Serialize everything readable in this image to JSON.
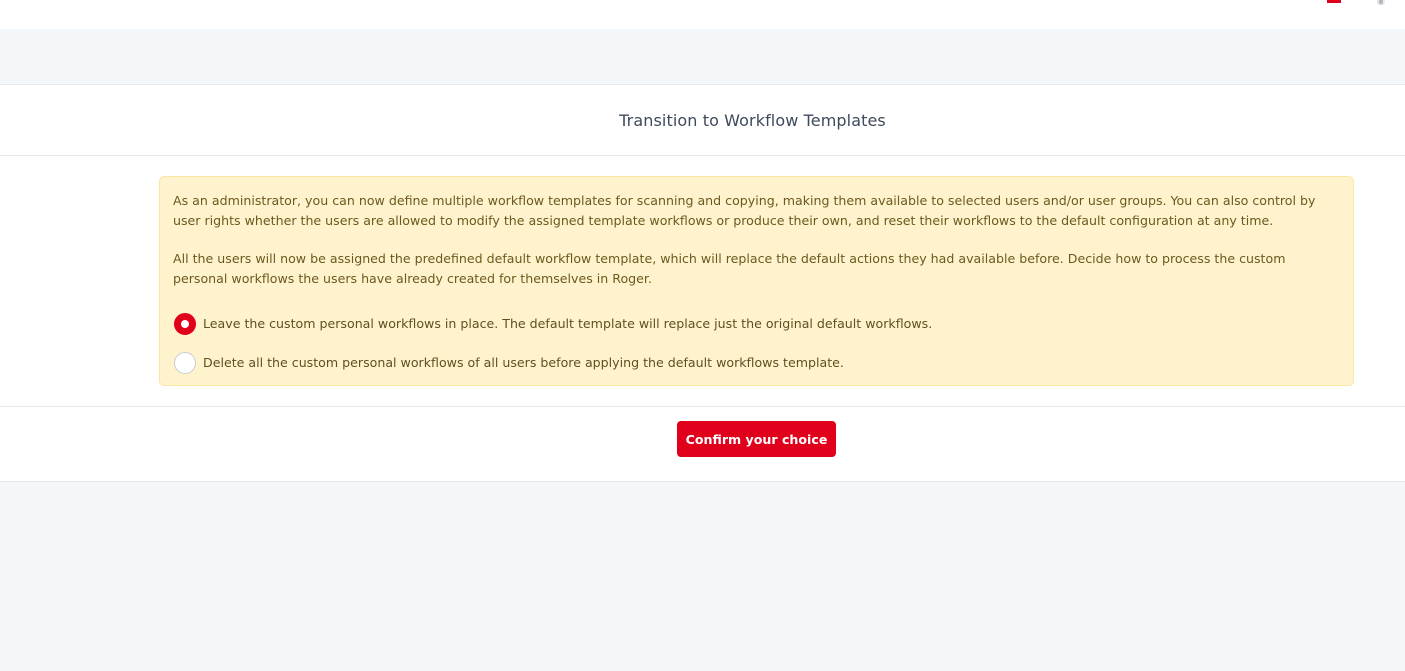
{
  "header": {
    "flag_icon": "flag-icon",
    "user_icon": "user-icon"
  },
  "dialog": {
    "title": "Transition to Workflow Templates",
    "paragraph1": "As an administrator, you can now define multiple workflow templates for scanning and copying, making them available to selected users and/or user groups. You can also control by user rights whether the users are allowed to modify the assigned template workflows or produce their own, and reset their workflows to the default configuration at any time.",
    "paragraph2": "All the users will now be assigned the predefined default workflow template, which will replace the default actions they had available before. Decide how to process the custom personal workflows the users have already created for themselves in Roger.",
    "options": [
      {
        "label": "Leave the custom personal workflows in place. The default template will replace just the original default workflows.",
        "checked": true
      },
      {
        "label": "Delete all the custom personal workflows of all users before applying the default workflows template.",
        "checked": false
      }
    ],
    "confirm_label": "Confirm your choice"
  },
  "colors": {
    "accent": "#e0001b",
    "notice_bg": "#fff3cd",
    "page_bg": "#f4f7fa"
  }
}
